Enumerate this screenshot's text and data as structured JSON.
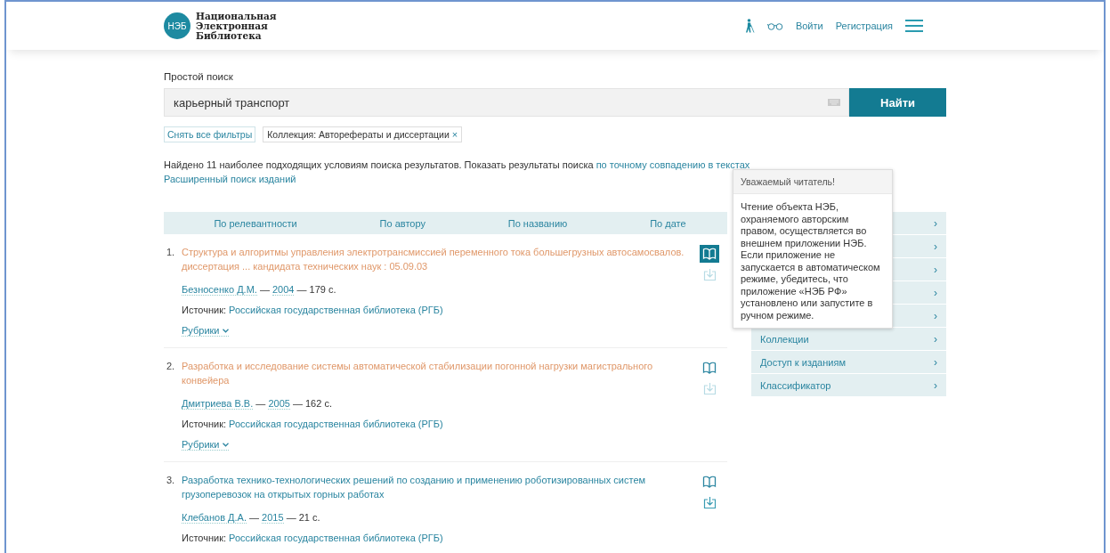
{
  "header": {
    "logo_badge": "НЭБ",
    "logo_lines": [
      "Национальная",
      "Электронная",
      "Библиотека"
    ],
    "links": [
      "Войти",
      "Регистрация"
    ]
  },
  "search": {
    "label": "Простой поиск",
    "value": "карьерный транспорт",
    "button": "Найти"
  },
  "filters": {
    "clear": "Снять все фильтры",
    "tags": [
      {
        "label": "Коллекция: Авторефераты и диссертации",
        "remove": "×"
      }
    ]
  },
  "summary": {
    "text": "Найдено 11 наиболее подходящих условиям поиска результатов. Показать результаты поиска",
    "exact_link": "по точному совпадению в текстах",
    "advanced_link": "Расширенный поиск изданий"
  },
  "sort": [
    "По релевантности",
    "По автору",
    "По названию",
    "По дате"
  ],
  "results": [
    {
      "number": "1.",
      "title": "Структура и алгоритмы управления электротрансмиссией переменного тока большегрузных автосамосвалов. диссертация ... кандидата технических наук : 05.09.03",
      "visited": true,
      "author": "Безносенко Д.М.",
      "dash": "—",
      "year": "2004",
      "pages": "— 179 с.",
      "source_label": "Источник:",
      "source": "Российская государственная библиотека (РГБ)",
      "rubrics": "Рубрики",
      "read_active": true,
      "download_enabled": false
    },
    {
      "number": "2.",
      "title": "Разработка и исследование системы автоматической стабилизации погонной нагрузки магистрального конвейера",
      "visited": true,
      "author": "Дмитриева В.В.",
      "dash": "—",
      "year": "2005",
      "pages": "— 162 с.",
      "source_label": "Источник:",
      "source": "Российская государственная библиотека (РГБ)",
      "rubrics": "Рубрики",
      "read_active": false,
      "download_enabled": false
    },
    {
      "number": "3.",
      "title": "Разработка технико-технологических решений по созданию и применению роботизированных систем грузоперевозок на открытых горных работах",
      "visited": false,
      "author": "Клебанов Д.А.",
      "dash": "—",
      "year": "2015",
      "pages": "— 21 с.",
      "source_label": "Источник:",
      "source": "Российская государственная библиотека (РГБ)",
      "read_active": false,
      "download_enabled": true
    }
  ],
  "sidebar": {
    "items": [
      {
        "chevron": "›"
      },
      {
        "chevron": "›"
      },
      {
        "chevron": "›"
      },
      {
        "chevron": "›"
      },
      {
        "chevron": "›"
      },
      {
        "label": "Коллекции",
        "chevron": "›"
      },
      {
        "label": "Доступ к изданиям",
        "chevron": "›"
      },
      {
        "label": "Классификатор",
        "chevron": "›"
      }
    ]
  },
  "tooltip": {
    "title": "Уважаемый читатель!",
    "body": "Чтение объекта НЭБ, охраняемого авторским правом, осуществляется во внешнем приложении НЭБ. Если приложение не запускается в автоматическом режиме, убедитесь, что приложение «НЭБ РФ» установлено или запустите в ручном режиме."
  }
}
